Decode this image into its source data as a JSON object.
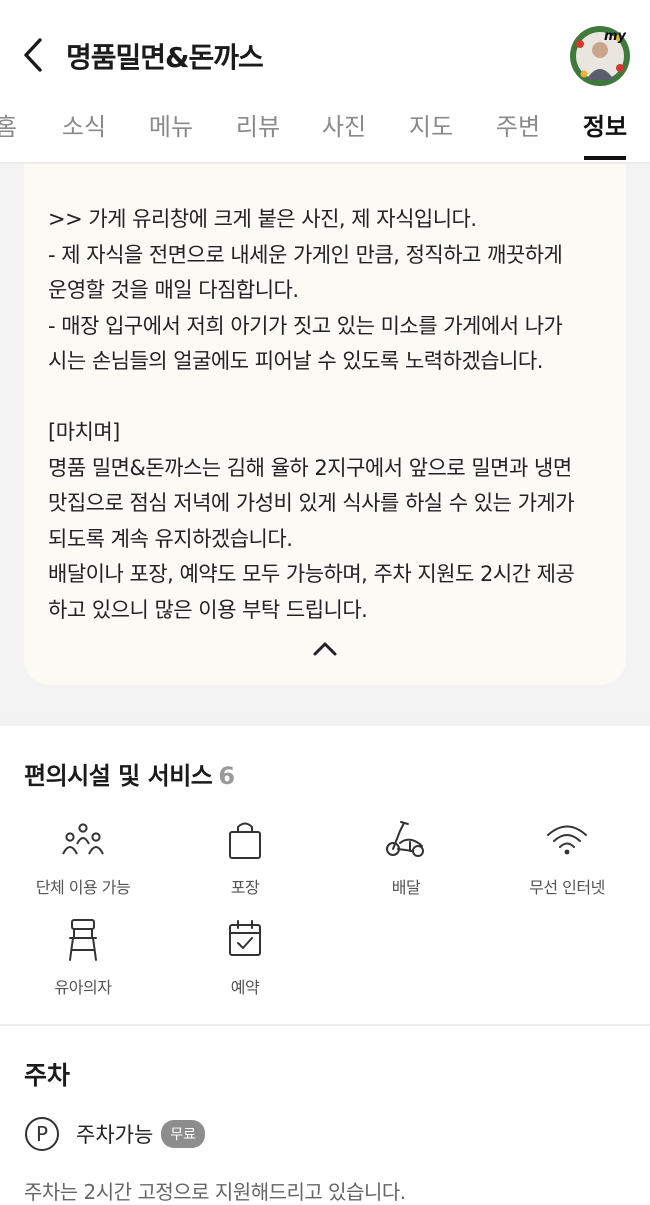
{
  "header": {
    "title": "명품밀면&돈까스",
    "avatar_badge": "my"
  },
  "tabs": [
    {
      "label": "홈"
    },
    {
      "label": "소식"
    },
    {
      "label": "메뉴"
    },
    {
      "label": "리뷰"
    },
    {
      "label": "사진"
    },
    {
      "label": "지도"
    },
    {
      "label": "주변"
    },
    {
      "label": "정보",
      "active": true
    }
  ],
  "intro": {
    "text": ">> 가게 유리창에 크게 붙은 사진, 제 자식입니다.\n- 제 자식을 전면으로 내세운 가게인 만큼, 정직하고 깨끗하게\n운영할 것을 매일 다짐합니다.\n- 매장 입구에서 저희 아기가 짓고 있는 미소를 가게에서 나가\n시는 손님들의 얼굴에도 피어날 수 있도록 노력하겠습니다.\n\n[마치며]\n명품 밀면&돈까스는 김해 율하 2지구에서 앞으로 밀면과 냉면\n맛집으로 점심 저녁에 가성비 있게 식사를 하실 수 있는 가게가\n되도록 계속 유지하겠습니다.\n배달이나 포장, 예약도 모두 가능하며, 주차 지원도 2시간 제공\n하고 있으니 많은 이용 부탁 드립니다."
  },
  "amenities": {
    "title": "편의시설 및 서비스",
    "count": "6",
    "items": [
      {
        "label": "단체 이용 가능",
        "icon": "group-icon"
      },
      {
        "label": "포장",
        "icon": "shopping-bag-icon"
      },
      {
        "label": "배달",
        "icon": "scooter-icon"
      },
      {
        "label": "무선 인터넷",
        "icon": "wifi-icon"
      },
      {
        "label": "유아의자",
        "icon": "high-chair-icon"
      },
      {
        "label": "예약",
        "icon": "calendar-check-icon"
      }
    ]
  },
  "parking": {
    "title": "주차",
    "label": "주차가능",
    "badge": "무료",
    "note": "주차는 2시간 고정으로 지원해드리고 있습니다."
  },
  "colors": {
    "card_bg": "#fcfaf5",
    "section_bg": "#f3f3f3",
    "badge_bg": "#8d8d8d",
    "active_tab": "#111111"
  }
}
